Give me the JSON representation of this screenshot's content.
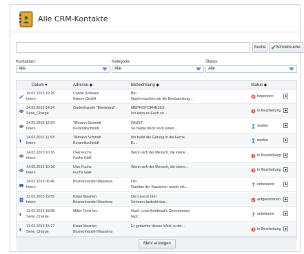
{
  "header": {
    "title": "Alle CRM-Kontakte",
    "app_icon": "book-icon"
  },
  "search": {
    "placeholder": "",
    "search_label": "Suche",
    "quick_search_label": "Schnellsuche"
  },
  "filters": [
    {
      "label": "Kontaktart:",
      "value": "Alle"
    },
    {
      "label": "Kategorie:",
      "value": "Alle"
    },
    {
      "label": "Status:",
      "value": "Alle"
    }
  ],
  "columns": {
    "date": "Datum ▾",
    "address": "Adresse ◆",
    "description": "Bezeichnung ◆",
    "status": "Status ◆"
  },
  "rows": [
    {
      "type_icon": "mail-icon",
      "date": "14.02.2013 19:26",
      "kind": "Intern",
      "addr1": "Carola Schwarz",
      "addr2": "Klamm GmbH",
      "desc1": "Bei",
      "desc2": "Nacht machten wir die Beobachtung,...",
      "status_icon": "start-icon",
      "status": "begonnen"
    },
    {
      "type_icon": "note-icon",
      "date": "14.02.2013 14:24",
      "kind": "Serie_Charge",
      "addr1": "Gartenhandel \"Bördeland\"",
      "addr2": "",
      "desc1": "MEPHISTOPHELES:",
      "desc2": "Ich kann es Euch so...",
      "status_icon": "progress-icon",
      "status": "In Bearbeitung"
    },
    {
      "type_icon": "note-icon",
      "date": "14.02.2013 12:54",
      "kind": "Intern",
      "addr1": "Tillmann Schmidt",
      "addr2": "Keramikschmidt",
      "desc1": "FAUST:",
      "desc2": "So bleibe doch noch einen...",
      "status_icon": "hourglass-icon",
      "status": "warten"
    },
    {
      "type_icon": "phone-icon",
      "date": "14.02.2013 11:53",
      "kind": "Intern",
      "addr1": "Tillmann Schmidt",
      "addr2": "Keramikschmidt",
      "desc1": "Ihn treibt die Gärung in die Ferne,",
      "desc2": "Er...",
      "status_icon": "hourglass-icon",
      "status": "warten"
    },
    {
      "type_icon": "note-icon",
      "date": "14.02.2013 10:16",
      "kind": "Intern",
      "addr1": "Uwe Fuchs",
      "addr2": "Fuchs GbR",
      "desc1": "Wenn sich der Mensch, die kleine...",
      "desc2": "",
      "status_icon": "progress-icon",
      "status": "In Bearbeitung"
    },
    {
      "type_icon": "note-icon",
      "date": "14.02.2013 10:16",
      "kind": "Intern",
      "addr1": "Uwe Fuchs",
      "addr2": "Fuchs GbR",
      "desc1": "Wenn sich der Mensch, die kleine...",
      "desc2": "",
      "status_icon": "progress-icon",
      "status": "In Bearbeitung"
    },
    {
      "type_icon": "car-icon",
      "date": "14.02.2013 06:46",
      "kind": "Intern",
      "addr1": "Blumenhandel Maartens",
      "addr2": "",
      "desc1": "Der",
      "desc2": "Gardian der Kapuziner wurde mit...",
      "status_icon": "question-icon",
      "status": "unbekannt"
    },
    {
      "type_icon": "doc-icon",
      "date": "13.02.2013 19:55",
      "kind": "Intern",
      "addr1": "Klaas Maarten",
      "addr2": "Blumenhandel Maartens",
      "desc1": "Die Lava in drei",
      "desc2": "Strömen bedroht das...",
      "status_icon": "taken-icon",
      "status": "aufgenommen"
    },
    {
      "type_icon": "phone-icon",
      "date": "13.02.2013 18:58",
      "kind": "Serie_Charge",
      "addr1": "Miller Tools Inc.",
      "addr2": "",
      "desc1": "Nach Louis Berthoud's Chronometer",
      "desc2": "liegt...",
      "status_icon": "question-icon",
      "status": "unbekannt"
    },
    {
      "type_icon": "phone-icon",
      "date": "13.02.2013 15:27",
      "kind": "Serie_Charge",
      "addr1": "Klaas Maarten",
      "addr2": "Blumenhandel Maartens",
      "desc1": "Er gedachte dieses Werk in der...",
      "desc2": "",
      "status_icon": "progress-icon",
      "status": "In Bearbeitung"
    }
  ],
  "more_label": "Mehr anzeigen",
  "colors": {
    "accent": "#5a8ec8",
    "progress": "#d9534f",
    "check": "#2fa02f"
  }
}
